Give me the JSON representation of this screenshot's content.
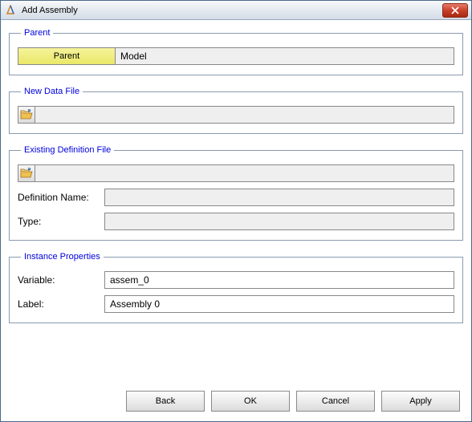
{
  "window": {
    "title": "Add Assembly"
  },
  "parent_section": {
    "legend": "Parent",
    "button_label": "Parent",
    "value": "Model"
  },
  "newfile_section": {
    "legend": "New Data File",
    "path": ""
  },
  "existing_section": {
    "legend": "Existing Definition File",
    "path": "",
    "defname_label": "Definition Name:",
    "defname_value": "",
    "type_label": "Type:",
    "type_value": ""
  },
  "instance_section": {
    "legend": "Instance Properties",
    "variable_label": "Variable:",
    "variable_value": "assem_0",
    "label_label": "Label:",
    "label_value": "Assembly 0"
  },
  "buttons": {
    "back": "Back",
    "ok": "OK",
    "cancel": "Cancel",
    "apply": "Apply"
  }
}
